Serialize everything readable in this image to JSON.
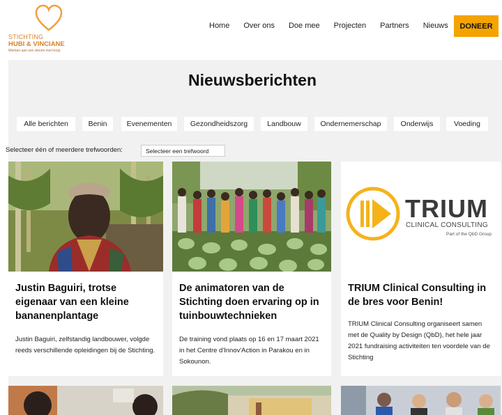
{
  "logo": {
    "line1": "STICHTING",
    "line2": "HUBI & VINCIANE",
    "tagline": "Werken aan een droom met hoop"
  },
  "nav": {
    "items": [
      "Home",
      "Over ons",
      "Doe mee",
      "Projecten",
      "Partners",
      "Nieuws"
    ],
    "donate": "DONEER"
  },
  "page": {
    "title": "Nieuwsberichten"
  },
  "filters": {
    "chips": [
      "Alle berichten",
      "Benin",
      "Evenementen",
      "Gezondheidszorg",
      "Landbouw",
      "Ondernemerschap",
      "Onderwijs",
      "Voeding"
    ],
    "keyword_label": "Selecteer één of meerdere trefwoorden:",
    "keyword_placeholder": "Selecteer een trefwoord"
  },
  "cards": [
    {
      "title": "Justin Baguiri, trotse eigenaar van een kleine bananenplantage",
      "excerpt": "Justin Baguiri, zelfstandig landbouwer, volgde reeds verschillende opleidingen bij de Stichting."
    },
    {
      "title": "De animatoren van de Stichting doen ervaring op in tuinbouwtechnieken",
      "excerpt": "De training vond plaats op 16 en 17 maart 2021 in het Centre d'Innov'Action in Parakou en in Sokounon."
    },
    {
      "title": "TRIUM Clinical Consulting in de bres voor Benin!",
      "excerpt": "TRIUM Clinical Consulting organiseert samen met de Quality by Design (QbD), het hele jaar 2021 fundraising activiteiten ten voordele van de Stichting",
      "logo_word": "TRIUM",
      "logo_sub": "CLINICAL CONSULTING",
      "logo_part": "Part of the QbD Group"
    }
  ],
  "colors": {
    "accent": "#f5a300",
    "logo_orange": "#d9822b",
    "page_gray": "#f1f1f1"
  }
}
